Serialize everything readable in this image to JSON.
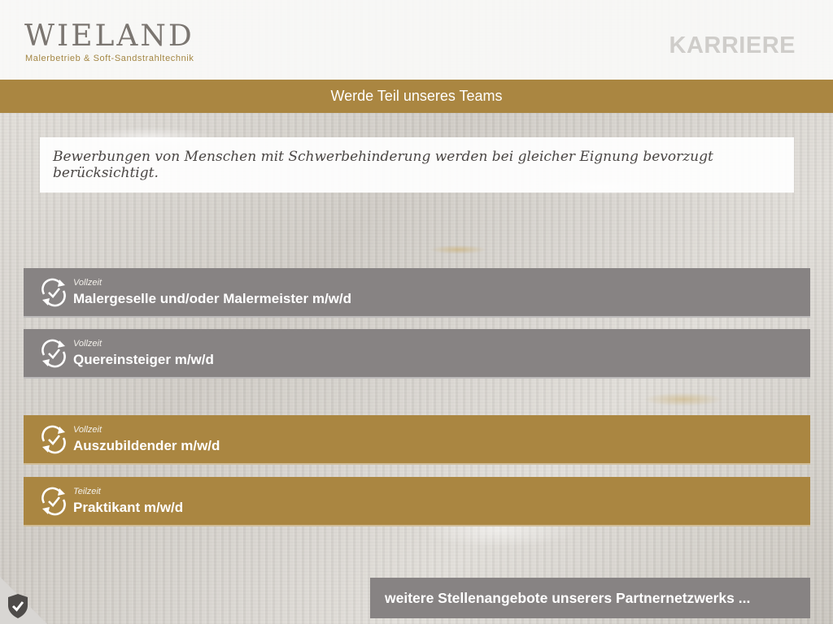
{
  "header": {
    "logo_word": "WIELAND",
    "logo_subtitle": "Malerbetrieb & Soft-Sandstrahltechnik",
    "section_label": "KARRIERE"
  },
  "titlebar": {
    "text": "Werde Teil unseres Teams"
  },
  "notice": {
    "text": "Bewerbungen von Menschen mit Schwerbehinderung werden bei gleicher Eignung bevorzugt berücksichtigt."
  },
  "jobs": [
    {
      "type": "Vollzeit",
      "title": "Malergeselle und/oder Malermeister m/w/d",
      "color": "#878383",
      "icon": "refresh-check-icon"
    },
    {
      "type": "Vollzeit",
      "title": "Quereinsteiger m/w/d",
      "color": "#878383",
      "icon": "refresh-check-icon"
    },
    {
      "type": "Vollzeit",
      "title": "Auszubildender m/w/d",
      "color": "#aa8641",
      "icon": "refresh-check-icon"
    },
    {
      "type": "Teilzeit",
      "title": "Praktikant m/w/d",
      "color": "#aa8641",
      "icon": "refresh-check-icon"
    }
  ],
  "more_offers": {
    "label": "weitere Stellenangebote unserers Partnernetzwerks ..."
  },
  "privacy_badge": {
    "icon": "shield-check-icon"
  },
  "colors": {
    "gold": "#aa8641",
    "grey": "#878383",
    "logo_grey": "#7b7671",
    "karriere_grey": "#cfcdca"
  }
}
